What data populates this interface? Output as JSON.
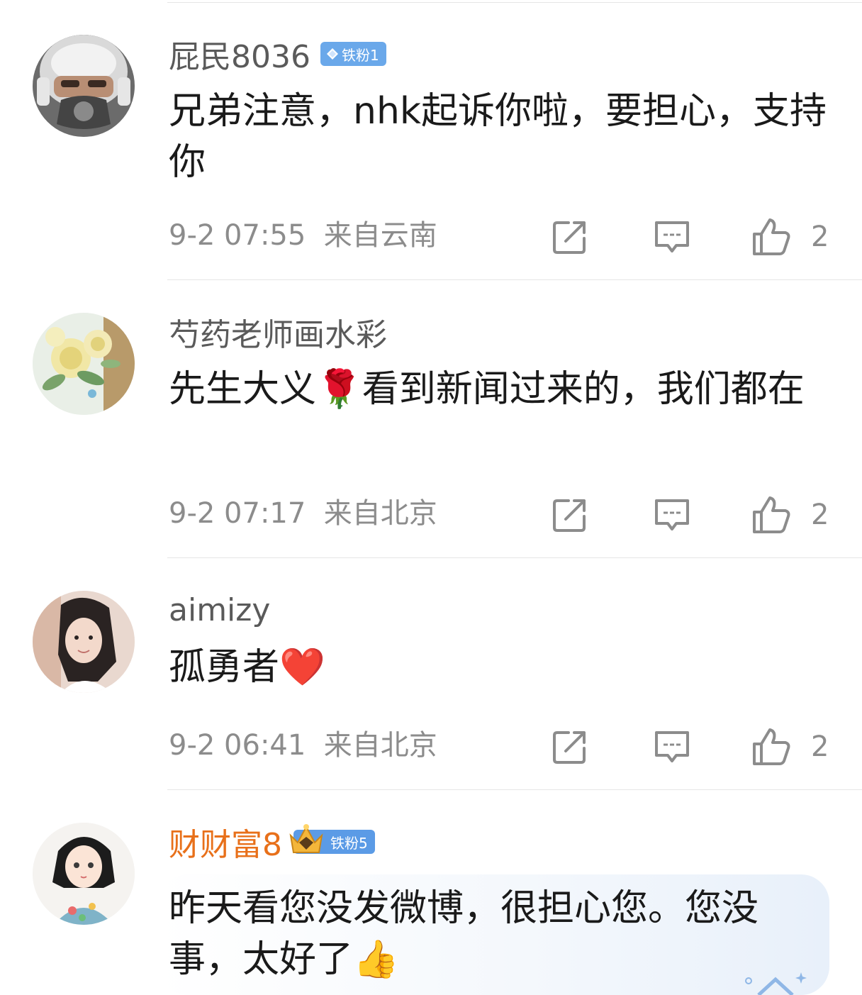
{
  "comments": [
    {
      "username": "屁民8036",
      "badge": "铁粉1",
      "text": "兄弟注意，nhk起诉你啦，要担心，支持你",
      "time": "9-2 07:55",
      "location": "来自云南",
      "likes": "2",
      "avatar_icon": "pilot-helmet-avatar"
    },
    {
      "username": "芍药老师画水彩",
      "badge": "",
      "text": "先生大义🌹看到新闻过来的，我们都在",
      "time": "9-2 07:17",
      "location": "来自北京",
      "likes": "2",
      "avatar_icon": "watercolor-roses-avatar"
    },
    {
      "username": "aimizy",
      "badge": "",
      "text": "孤勇者❤️",
      "time": "9-2 06:41",
      "location": "来自北京",
      "likes": "2",
      "avatar_icon": "girl-portrait-avatar"
    },
    {
      "username": "财财富8",
      "badge": "铁粉5",
      "text": "昨天看您没发微博，很担心您。您没事，太好了👍",
      "time": "",
      "location": "",
      "likes": "",
      "avatar_icon": "illustrated-girl-avatar"
    }
  ],
  "colors": {
    "gold_name": "#e8701a",
    "badge_blue": "#6aa8ea",
    "meta_gray": "#8c8c8c"
  }
}
